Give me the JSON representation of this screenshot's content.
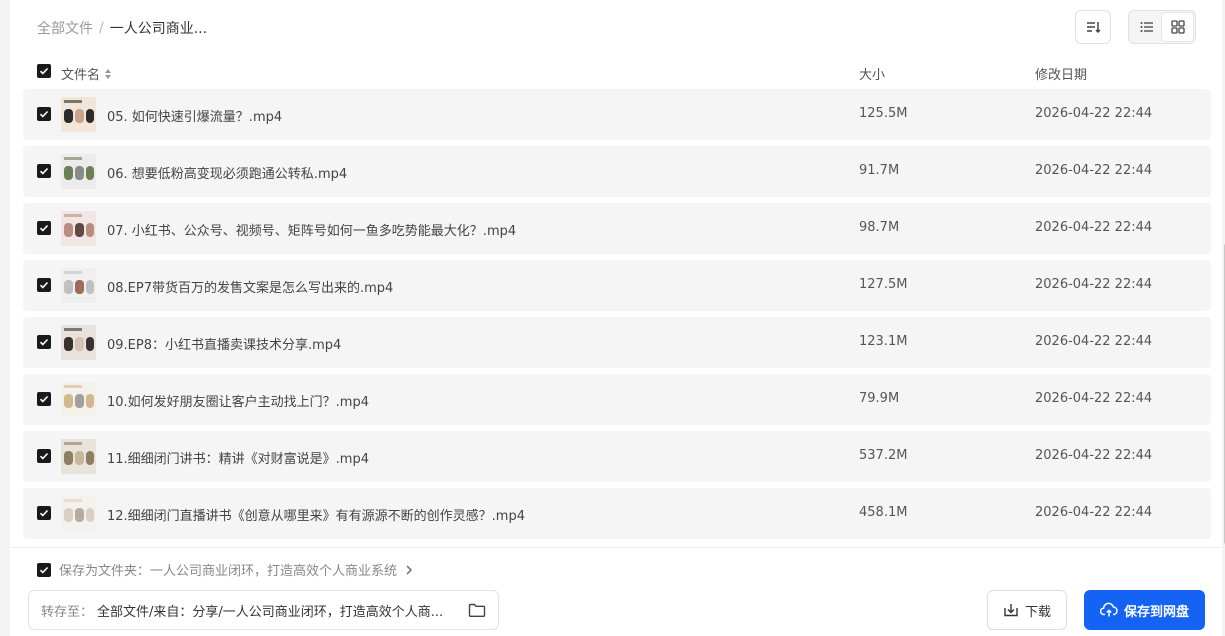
{
  "breadcrumb": {
    "root": "全部文件",
    "separator": "/",
    "current": "一人公司商业..."
  },
  "table_header": {
    "name": "文件名",
    "size": "大小",
    "date": "修改日期"
  },
  "files": [
    {
      "name": "05. 如何快速引爆流量？.mp4",
      "size": "125.5M",
      "date": "2026-04-22 22:44"
    },
    {
      "name": "06. 想要低粉高变现必须跑通公转私.mp4",
      "size": "91.7M",
      "date": "2026-04-22 22:44"
    },
    {
      "name": "07. 小红书、公众号、视频号、矩阵号如何一鱼多吃势能最大化？.mp4",
      "size": "98.7M",
      "date": "2026-04-22 22:44"
    },
    {
      "name": "08.EP7带货百万的发售文案是怎么写出来的.mp4",
      "size": "127.5M",
      "date": "2026-04-22 22:44"
    },
    {
      "name": "09.EP8：小红书直播卖课技术分享.mp4",
      "size": "123.1M",
      "date": "2026-04-22 22:44"
    },
    {
      "name": "10.如何发好朋友圈让客户主动找上门？.mp4",
      "size": "79.9M",
      "date": "2026-04-22 22:44"
    },
    {
      "name": "11.细细闭门讲书：精讲《对财富说是》.mp4",
      "size": "537.2M",
      "date": "2026-04-22 22:44"
    },
    {
      "name": "12.细细闭门直播讲书《创意从哪里来》有有源源不断的创作灵感？.mp4",
      "size": "458.1M",
      "date": "2026-04-22 22:44"
    }
  ],
  "footer": {
    "save_as_folder": "保存为文件夹：一人公司商业闭环，打造高效个人商业系统",
    "dest_label": "转存至：",
    "dest_value": "全部文件/来自：分享/一人公司商业闭环，打造高效个人商...",
    "download_label": "下载",
    "save_label": "保存到网盘"
  },
  "colors": {
    "primary": "#1463f5",
    "row_bg": "#f5f5f5",
    "checkbox": "#1a1a1a"
  }
}
